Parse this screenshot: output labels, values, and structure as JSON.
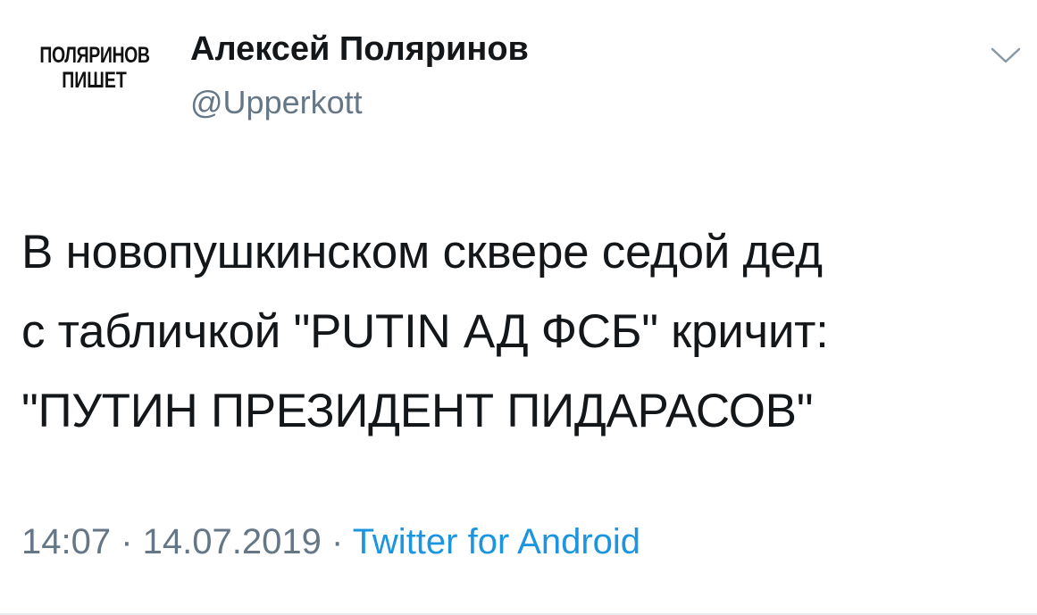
{
  "avatar": {
    "line1": "ПОЛЯРИНОВ",
    "line2": "ПИШЕТ"
  },
  "author": {
    "name": "Алексей Поляринов",
    "handle": "@Upperkott"
  },
  "menu": {
    "icon": "chevron-down-icon"
  },
  "tweet": {
    "lines": [
      "В новопушкинском сквере седой дед",
      "с табличкой \"PUTIN АД ФСБ\" кричит:",
      "\"ПУТИН ПРЕЗИДЕНТ ПИДАРАСОВ\""
    ]
  },
  "meta": {
    "time": "14:07",
    "separator1": " · ",
    "date": "14.07.2019",
    "separator2": " · ",
    "source": "Twitter for Android"
  },
  "colors": {
    "text": "#14171a",
    "muted": "#657786",
    "link": "#1b95e0"
  }
}
